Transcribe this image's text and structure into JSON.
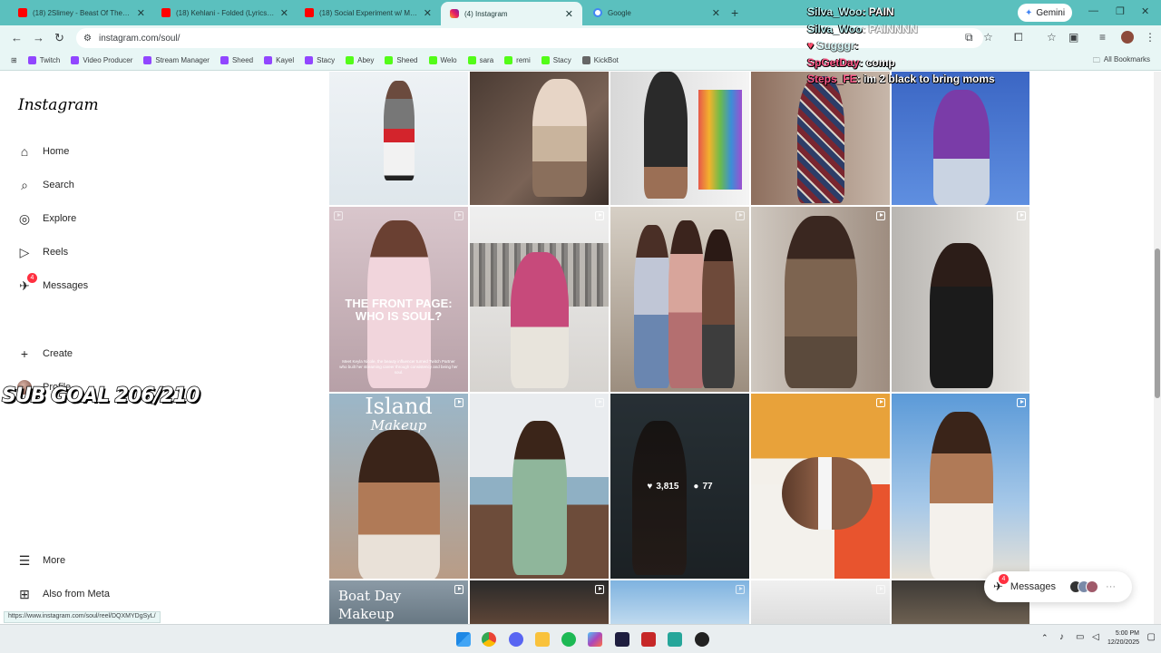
{
  "tabs": [
    {
      "title": "(18) 2Slimey - Beast Of The Be...",
      "icon": "youtube-icon"
    },
    {
      "title": "(18) Kehlani - Folded (Lyrics) - Yo...",
      "icon": "youtube-icon"
    },
    {
      "title": "(18) Social Experiment w/ MIN...",
      "icon": "youtube-icon"
    },
    {
      "title": "(4) Instagram",
      "icon": "instagram-icon"
    },
    {
      "title": "Google",
      "icon": "google-icon"
    }
  ],
  "gemini_label": "Gemini",
  "address": "instagram.com/soul/",
  "bookmarks": [
    "Twitch",
    "Video Producer",
    "Stream Manager",
    "Sheed",
    "Kayel",
    "Stacy",
    "Abey",
    "Sheed",
    "Welo",
    "sara",
    "remi",
    "Stacy",
    "KickBot"
  ],
  "all_bookmarks": "All Bookmarks",
  "sidebar": {
    "logo": "Instagram",
    "items": [
      {
        "label": "Home",
        "icon": "home-icon"
      },
      {
        "label": "Search",
        "icon": "search-icon"
      },
      {
        "label": "Explore",
        "icon": "compass-icon"
      },
      {
        "label": "Reels",
        "icon": "reels-icon"
      },
      {
        "label": "Messages",
        "icon": "messenger-icon",
        "badge": "4"
      },
      {
        "label": "Create",
        "icon": "plus-icon"
      },
      {
        "label": "Profile",
        "icon": "avatar"
      }
    ],
    "more": "More",
    "also_from_meta": "Also from Meta"
  },
  "stream_overlay": {
    "sub_goal": "SUB GOAL 206/210",
    "chat": [
      {
        "user": "Silva_Woo",
        "text": ": PAIN"
      },
      {
        "user": "Silva_Woo",
        "text": ": PAINNNN"
      },
      {
        "user": "Sugggr",
        "text": ":"
      },
      {
        "user": "SpGetDay",
        "text": ": comp"
      },
      {
        "user": "Steps_FE",
        "text": ": im 2 black to bring moms"
      }
    ]
  },
  "grid": {
    "post_texts": {
      "front_page": "THE FRONT PAGE: WHO IS SOUL?",
      "front_page_caption": "Meet Keyla Nicole, the beauty influencer turned Twitch Partner who built her streaming career through consistency and being her soul.",
      "island_1": "Island",
      "island_2": "Makeup",
      "boat_1": "Boat Day",
      "boat_2": "Makeup"
    },
    "hover_likes": "3,815",
    "hover_comments": "77"
  },
  "messages_pill": {
    "label": "Messages",
    "badge": "4"
  },
  "status_url": "https://www.instagram.com/soul/reel/DQXMYDgSyL/",
  "clock": {
    "time": "5:00 PM",
    "date": "12/20/2025"
  },
  "colors": {
    "tab_strip": "#5bc0be",
    "toolbar": "#e8f6f5",
    "badge": "#ff3040"
  }
}
